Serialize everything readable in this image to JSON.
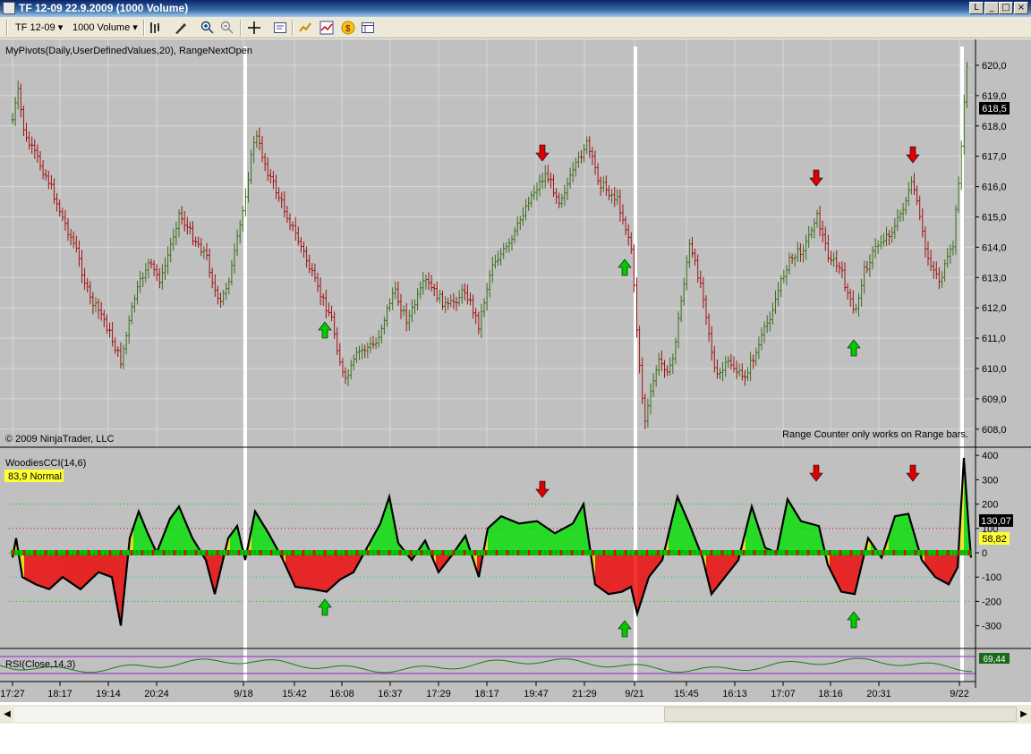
{
  "window": {
    "title": "TF 12-09  22.9.2009 (1000 Volume)"
  },
  "toolbar": {
    "instrument": "TF 12-09",
    "period": "1000 Volume"
  },
  "panel_price": {
    "label": "MyPivots(Daily,UserDefinedValues,20), RangeNextOpen",
    "copyright": "© 2009 NinjaTrader, LLC",
    "note": "Range Counter only works on Range bars.",
    "y_ticks": [
      "620,0",
      "619,0",
      "618,0",
      "617,0",
      "616,0",
      "615,0",
      "614,0",
      "613,0",
      "612,0",
      "611,0",
      "610,0",
      "609,0",
      "608,0"
    ],
    "current_price": "618,5"
  },
  "panel_cci": {
    "label": "WoodiesCCI(14,6)",
    "badge": "83,9 Normal",
    "y_ticks": [
      "400",
      "300",
      "200",
      "100",
      "0",
      "-100",
      "-200",
      "-300"
    ],
    "value1": "130,07",
    "value2": "58,82"
  },
  "panel_rsi": {
    "label": "RSI(Close,14,3)",
    "value": "69,44"
  },
  "x_axis": {
    "labels": [
      "17:27",
      "18:17",
      "19:14",
      "20:24",
      "9/18",
      "15:42",
      "16:08",
      "16:37",
      "17:29",
      "18:17",
      "19:47",
      "21:29",
      "9/21",
      "15:45",
      "16:13",
      "17:07",
      "18:16",
      "20:31",
      "9/22"
    ]
  },
  "colors": {
    "up_bar": "#3a6e1a",
    "down_bar": "#a01010",
    "cci_pos": "#00e000",
    "cci_neg": "#ee0000",
    "cci_turn": "#e8e000",
    "rsi": "#1a7a1a",
    "session_break": "#ffffff"
  },
  "chart_data": {
    "type": "line",
    "series": [],
    "annotations": {
      "down_arrows_price": [
        606,
        912,
        1020
      ],
      "up_arrows_price": [
        363,
        698,
        954
      ]
    }
  }
}
